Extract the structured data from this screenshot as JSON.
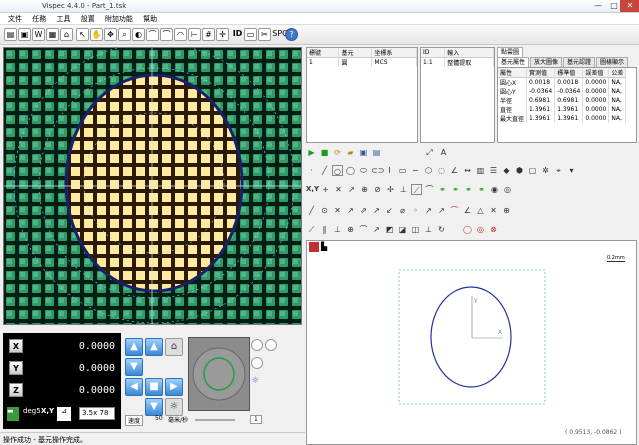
{
  "window": {
    "title": "Vispec 4.4.0 - Part_1.tsk",
    "minimize": "—",
    "maximize": "□",
    "close": "✕"
  },
  "menu": [
    "文件",
    "任務",
    "工具",
    "設置",
    "附加功能",
    "幫助"
  ],
  "toolbar": {
    "id_label": "ID",
    "spc_label": "SPC"
  },
  "dro": {
    "axes": [
      {
        "label": "X",
        "value": "0.0000"
      },
      {
        "label": "Y",
        "value": "0.0000"
      },
      {
        "label": "Z",
        "value": "0.0000"
      }
    ],
    "tools": {
      "deg_label": "deg5",
      "xy_label": "X,Y",
      "zoom": "3.5x 78"
    }
  },
  "jog": {
    "speed_label": "速度",
    "speed_value": "50",
    "unit_label": "毫米/秒",
    "step_value": "1"
  },
  "status": {
    "text": "操作成功 - 基元操作完成。"
  },
  "feature_table": {
    "headers": [
      "標號",
      "基元",
      "坐標系"
    ],
    "rows": [
      [
        "1",
        "圓",
        "MCS"
      ]
    ]
  },
  "op_table": {
    "headers": [
      "ID",
      "輸入"
    ],
    "rows": [
      [
        "1:1",
        "整體提取"
      ]
    ]
  },
  "prop_tabs": {
    "row1": [
      "點雲圖"
    ],
    "row2": [
      "基元屬性",
      "放大圖像",
      "基元認證",
      "圖樣顯示"
    ]
  },
  "prop_table": {
    "headers": [
      "屬性",
      "實測值",
      "標準值",
      "誤差值",
      "公差"
    ],
    "rows": [
      [
        "圓心X",
        "0.0018",
        "0.0018",
        "0.0000",
        "NA,"
      ],
      [
        "圓心Y",
        "-0.0364",
        "-0.0364",
        "0.0000",
        "NA,"
      ],
      [
        "半徑",
        "0.6981",
        "0.6981",
        "0.0000",
        "NA,"
      ],
      [
        "直徑",
        "1.3961",
        "1.3961",
        "0.0000",
        "NA,"
      ],
      [
        "最大直徑",
        "1.3961",
        "1.3961",
        "0.0000",
        "NA,"
      ]
    ]
  },
  "drawing": {
    "scale_label": "0.2mm",
    "coord": "( 0.9513, -0.0862 )",
    "axis_y": "Y",
    "axis_x": "X"
  },
  "palette": {
    "letter_a": "A",
    "xy": "X,Y",
    "x_mark": "X"
  }
}
